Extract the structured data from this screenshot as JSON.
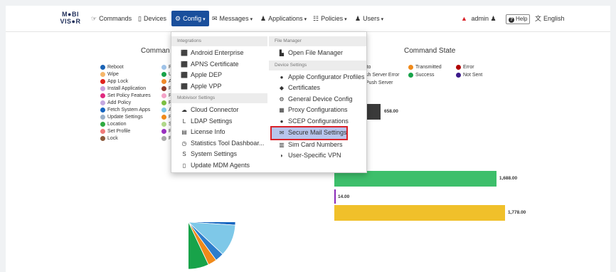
{
  "nav": {
    "logo_top": "M●BI",
    "logo_bottom": "VIS●R",
    "items": [
      {
        "label": "Commands",
        "icon": "☞"
      },
      {
        "label": "Devices",
        "icon": "▯"
      },
      {
        "label": "Config",
        "icon": "⚙"
      },
      {
        "label": "Messages",
        "icon": "✉"
      },
      {
        "label": "Applications",
        "icon": "♟"
      },
      {
        "label": "Policies",
        "icon": "☷"
      },
      {
        "label": "Users",
        "icon": "♟"
      }
    ],
    "user": "admin",
    "help": "Help",
    "language": "English"
  },
  "dropdown": {
    "left_sections": [
      {
        "header": "Integrations",
        "items": [
          "Android Enterprise",
          "APNS Certificate",
          "Apple DEP",
          "Apple VPP"
        ]
      },
      {
        "header": "Mobivisor Settings",
        "items": [
          "Cloud Connector",
          "LDAP Settings",
          "License Info",
          "Statistics Tool Dashboar...",
          "System Settings",
          "Update MDM Agents"
        ]
      }
    ],
    "right_sections": [
      {
        "header": "File Manager",
        "items": [
          "Open File Manager"
        ]
      },
      {
        "header": "Device Settings",
        "items": [
          "Apple Configurator Profiles",
          "Certificates",
          "General Device Config",
          "Proxy Configurations",
          "SCEP Configurations",
          "Secure Mail Settings",
          "Sim Card Numbers",
          "User-Specific VPN"
        ]
      }
    ]
  },
  "commands_chart": {
    "title_visible": "Comman",
    "legend_col1": [
      "Reboot",
      "Wipe",
      "App Lock",
      "Install Application",
      "Set Policy Features",
      "Add Policy",
      "Fetch System Apps",
      "Update Settings",
      "Location",
      "Set Profile",
      "Lock"
    ],
    "legend_col2": [
      "Pr",
      "Ur",
      "Ap",
      "Re",
      "Re",
      "Re",
      "Ap",
      "Po",
      "Se",
      "Re",
      "Pr"
    ]
  },
  "state_chart": {
    "title": "Command State",
    "legend_row1": [
      "ito",
      "Transmitted",
      "Error"
    ],
    "legend_row2": [
      "sh Server Error",
      "Success",
      "Not Sent"
    ],
    "legend_row3": [
      "Push Server"
    ]
  },
  "chart_data": {
    "type": "bar",
    "orientation": "horizontal",
    "title": "Command State",
    "bars": [
      {
        "value": 658.0,
        "label": "658.00",
        "color": "#3a3a3a"
      },
      {
        "value": 1688.0,
        "label": "1,688.00",
        "color": "#3dbf6b"
      },
      {
        "value": 14.0,
        "label": "14.00",
        "color": "#8a2ab8"
      },
      {
        "value": 1778.0,
        "label": "1,778.00",
        "color": "#f0c02a"
      }
    ]
  }
}
